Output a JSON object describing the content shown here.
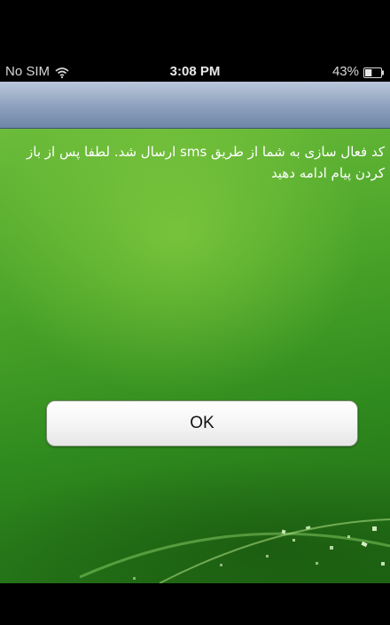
{
  "status_bar": {
    "carrier": "No SIM",
    "time": "3:08 PM",
    "battery_percent": "43%",
    "battery_level": 0.43,
    "wifi_icon": "wifi-icon",
    "battery_icon": "battery-icon"
  },
  "nav_bar": {
    "title": ""
  },
  "dialog": {
    "message": "کد فعال سازی به شما از طریق sms ارسال شد. لطفا پس از باز کردن پیام ادامه دهید",
    "ok_label": "OK"
  },
  "colors": {
    "background_green": "#4aa429",
    "nav_bar_blue": "#93a6c2",
    "button_white": "#ffffff"
  }
}
